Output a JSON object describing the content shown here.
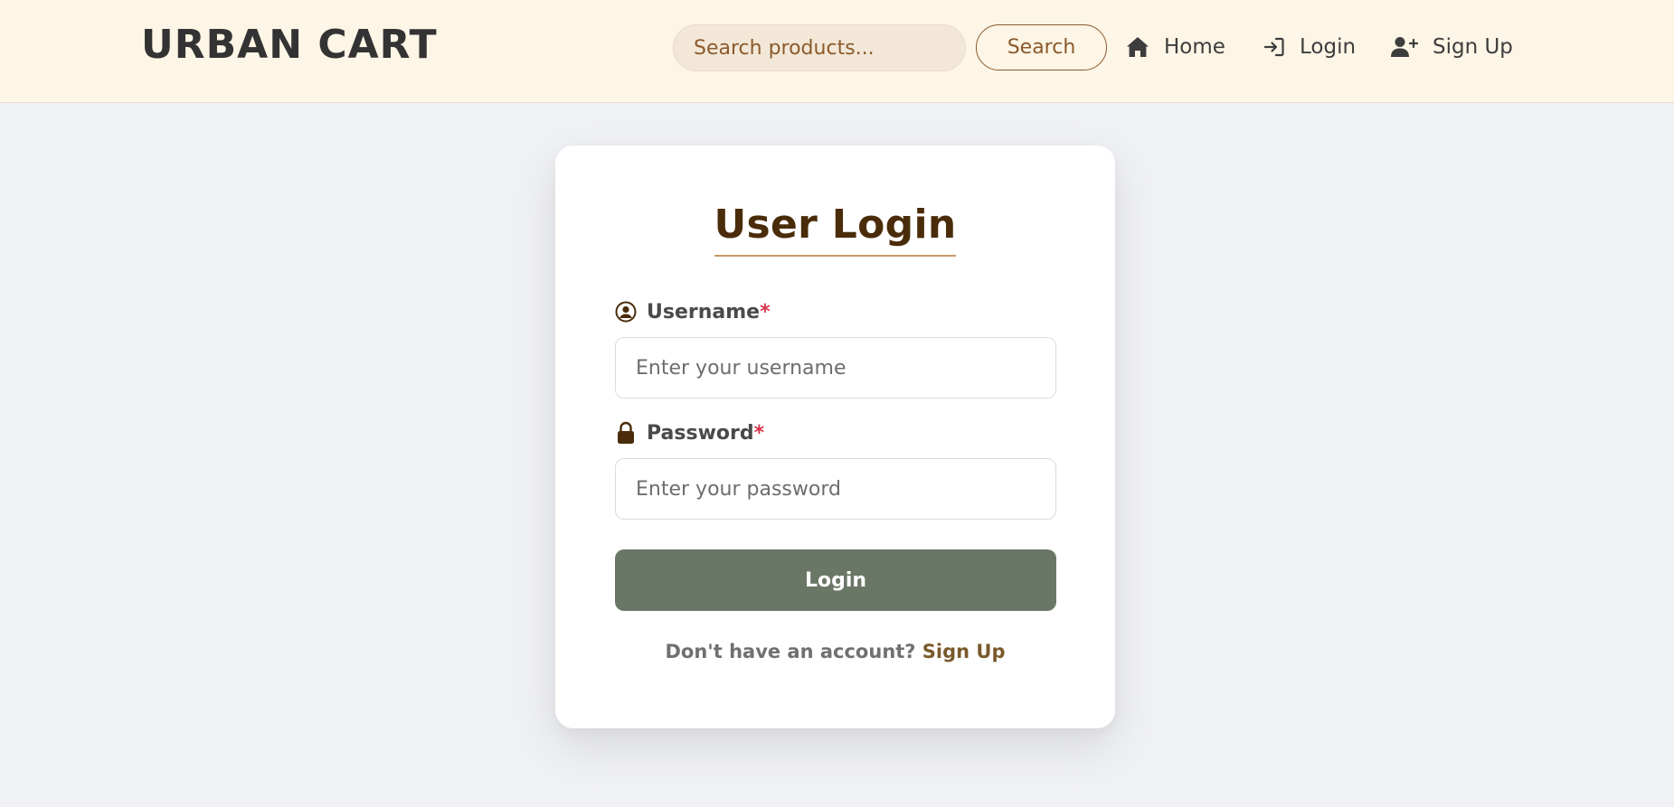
{
  "header": {
    "brand": "URBAN CART",
    "search": {
      "placeholder": "Search products...",
      "button_label": "Search"
    },
    "nav": [
      {
        "label": "Home",
        "icon": "home-icon"
      },
      {
        "label": "Login",
        "icon": "login-icon"
      },
      {
        "label": "Sign Up",
        "icon": "user-plus-icon"
      }
    ]
  },
  "login_card": {
    "title": "User Login",
    "username": {
      "label": "Username",
      "required_mark": "*",
      "placeholder": "Enter your username",
      "icon": "user-circle-icon"
    },
    "password": {
      "label": "Password",
      "required_mark": "*",
      "placeholder": "Enter your password",
      "icon": "lock-icon"
    },
    "submit_label": "Login",
    "signup_prompt": "Don't have an account?",
    "signup_link": "Sign Up"
  },
  "colors": {
    "header_bg": "#fdf5e6",
    "page_bg": "#f0f1f5",
    "accent_brown": "#8b5a2b",
    "title_brown": "#4a2c0a",
    "button_green": "#6b7766",
    "required_red": "#d6334a"
  }
}
